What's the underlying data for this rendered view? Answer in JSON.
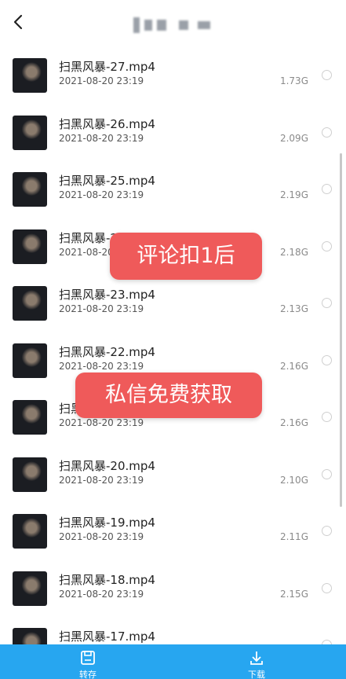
{
  "header": {
    "back_icon": "chevron-left-icon",
    "title_obscured": true
  },
  "files": [
    {
      "name": "扫黑风暴-27.mp4",
      "date": "2021-08-20 23:19",
      "size": "1.73G"
    },
    {
      "name": "扫黑风暴-26.mp4",
      "date": "2021-08-20 23:19",
      "size": "2.09G"
    },
    {
      "name": "扫黑风暴-25.mp4",
      "date": "2021-08-20 23:19",
      "size": "2.19G"
    },
    {
      "name": "扫黑风暴-24.mp4",
      "date": "2021-08-20 23:19",
      "size": "2.18G"
    },
    {
      "name": "扫黑风暴-23.mp4",
      "date": "2021-08-20 23:19",
      "size": "2.13G"
    },
    {
      "name": "扫黑风暴-22.mp4",
      "date": "2021-08-20 23:19",
      "size": "2.16G"
    },
    {
      "name": "扫黑风暴-21.mp4",
      "date": "2021-08-20 23:19",
      "size": "2.16G"
    },
    {
      "name": "扫黑风暴-20.mp4",
      "date": "2021-08-20 23:19",
      "size": "2.10G"
    },
    {
      "name": "扫黑风暴-19.mp4",
      "date": "2021-08-20 23:19",
      "size": "2.11G"
    },
    {
      "name": "扫黑风暴-18.mp4",
      "date": "2021-08-20 23:19",
      "size": "2.15G"
    },
    {
      "name": "扫黑风暴-17.mp4",
      "date": "",
      "size": ""
    }
  ],
  "overlays": {
    "banner1": "评论扣1后",
    "banner2": "私信免费获取"
  },
  "bottombar": {
    "save_label": "转存",
    "save_icon": "save-disk-icon",
    "download_label": "下载",
    "download_icon": "download-icon"
  },
  "colors": {
    "accent": "#27a6f0",
    "banner": "#ef5a5a"
  }
}
